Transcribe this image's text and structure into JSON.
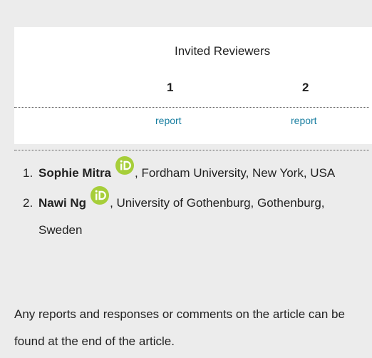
{
  "reviewers_panel": {
    "title": "Invited Reviewers",
    "columns": [
      {
        "number": "1",
        "report_label": "report"
      },
      {
        "number": "2",
        "report_label": "report"
      }
    ]
  },
  "reviewers": [
    {
      "index": "1.",
      "name": "Sophie Mitra",
      "affiliation": ", Fordham University, New York, USA"
    },
    {
      "index": "2.",
      "name": "Nawi Ng",
      "affiliation": ", University of Gothenburg, Gothenburg, Sweden"
    }
  ],
  "footer_note": "Any reports and responses or comments on the article can be found at the end of the article.",
  "colors": {
    "link": "#1a7fa1",
    "orcid_green": "#a6ce39",
    "background": "#ececec"
  },
  "icons": {
    "orcid": "orcid-icon"
  }
}
